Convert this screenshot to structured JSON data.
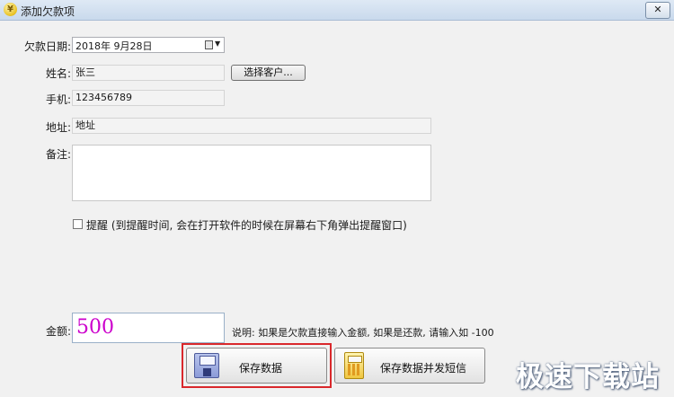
{
  "window": {
    "title": "添加欠款项",
    "close_glyph": "✕"
  },
  "form": {
    "date_label": "欠款日期:",
    "date_value": "2018年 9月28日",
    "name_label": "姓名:",
    "name_value": "张三",
    "select_customer_label": "选择客户...",
    "phone_label": "手机:",
    "phone_value": "123456789",
    "address_label": "地址:",
    "address_value": "地址",
    "notes_label": "备注:",
    "notes_value": "",
    "reminder_checked": false,
    "reminder_label": "提醒 (到提醒时间, 会在打开软件的时候在屏幕右下角弹出提醒窗口)",
    "amount_label": "金额:",
    "amount_value": "500",
    "hint": "说明: 如果是欠款直接输入金额, 如果是还款, 请输入如  -100"
  },
  "buttons": {
    "save_label": "保存数据",
    "save_sms_label": "保存数据并发短信"
  },
  "icons": {
    "app": "yen-coin-icon",
    "calendar": "calendar-icon",
    "save": "floppy-disk-icon",
    "sms": "calculator-phone-icon"
  },
  "colors": {
    "amount_text": "#cc00cc",
    "highlight_border": "#d9282c"
  },
  "watermark": "极速下载站"
}
